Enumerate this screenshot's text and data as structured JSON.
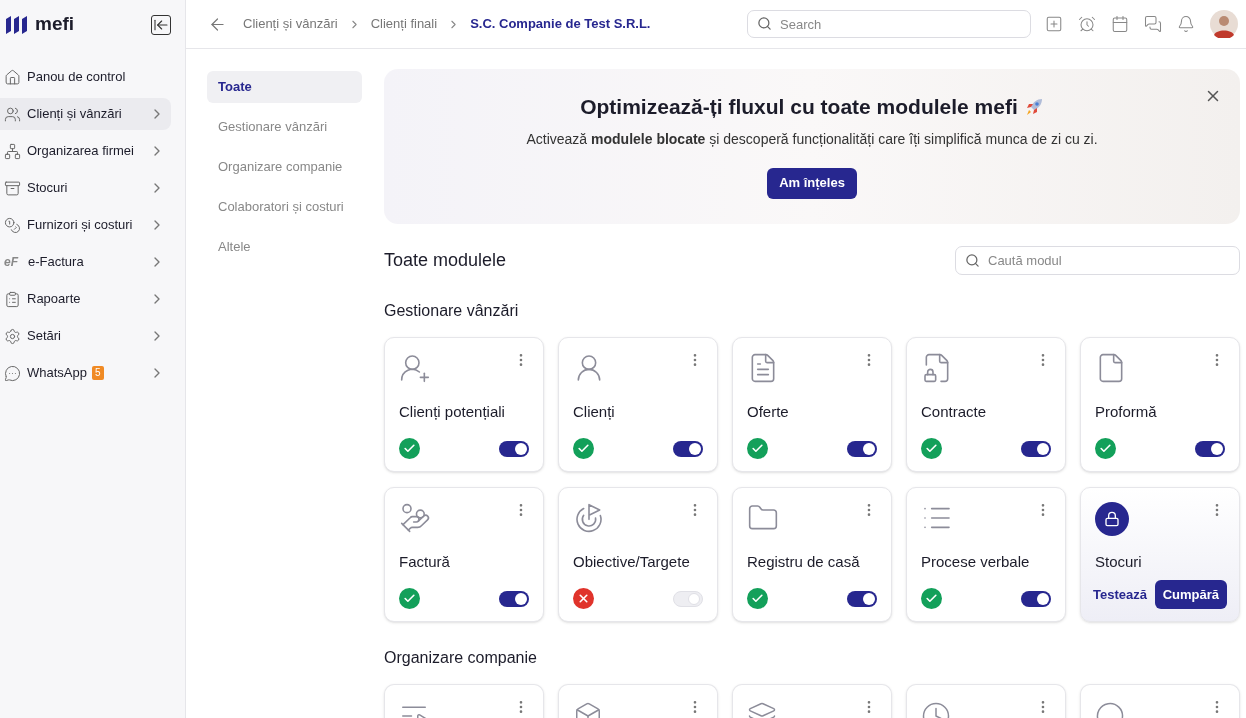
{
  "logo": {
    "text": "mefi"
  },
  "sidebar": {
    "items": [
      {
        "label": "Panou de control",
        "selected": false,
        "submenu": false
      },
      {
        "label": "Clienți și vânzări",
        "selected": true,
        "submenu": true
      },
      {
        "label": "Organizarea firmei",
        "selected": false,
        "submenu": true
      },
      {
        "label": "Stocuri",
        "selected": false,
        "submenu": true
      },
      {
        "label": "Furnizori și costuri",
        "selected": false,
        "submenu": true
      },
      {
        "label": "e-Factura",
        "selected": false,
        "submenu": true,
        "icon_text": "eF"
      },
      {
        "label": "Rapoarte",
        "selected": false,
        "submenu": true
      },
      {
        "label": "Setări",
        "selected": false,
        "submenu": true
      },
      {
        "label": "WhatsApp",
        "selected": false,
        "submenu": true,
        "badge": "5"
      }
    ]
  },
  "breadcrumbs": [
    "Clienți și vânzări",
    "Clienți finali",
    "S.C. Companie de Test S.R.L."
  ],
  "search": {
    "placeholder": "Search"
  },
  "filters": [
    {
      "label": "Toate",
      "selected": true
    },
    {
      "label": "Gestionare vânzări",
      "selected": false
    },
    {
      "label": "Organizare companie",
      "selected": false
    },
    {
      "label": "Colaboratori și costuri",
      "selected": false
    },
    {
      "label": "Altele",
      "selected": false
    }
  ],
  "banner": {
    "title": "Optimizează-ți fluxul cu toate modulele mefi",
    "text": "Activează **modulele blocate** și descoperă funcționalități care îți simplifică munca de zi cu zi.",
    "button": "Am înțeles"
  },
  "modules_title": "Toate modulele",
  "module_search": {
    "placeholder": "Caută modul"
  },
  "sections": [
    {
      "title": "Gestionare vânzări",
      "modules": [
        {
          "kind": "active",
          "name": "Clienți potențiali",
          "on": true
        },
        {
          "kind": "active",
          "name": "Clienți",
          "on": true
        },
        {
          "kind": "active",
          "name": "Oferte",
          "on": true
        },
        {
          "kind": "active",
          "name": "Contracte",
          "on": true
        },
        {
          "kind": "active",
          "name": "Proformă",
          "on": true
        },
        {
          "kind": "active",
          "name": "Factură",
          "on": true
        },
        {
          "kind": "active",
          "name": "Obiective/Targete",
          "on": false
        },
        {
          "kind": "active",
          "name": "Registru de casă",
          "on": true
        },
        {
          "kind": "active",
          "name": "Procese verbale",
          "on": true
        },
        {
          "kind": "locked",
          "name": "Stocuri",
          "try": "Testează",
          "buy": "Cumpără"
        }
      ]
    },
    {
      "title": "Organizare companie",
      "modules": [
        {
          "kind": "cut"
        },
        {
          "kind": "cut"
        },
        {
          "kind": "cut"
        },
        {
          "kind": "cut"
        },
        {
          "kind": "cut"
        }
      ]
    }
  ]
}
